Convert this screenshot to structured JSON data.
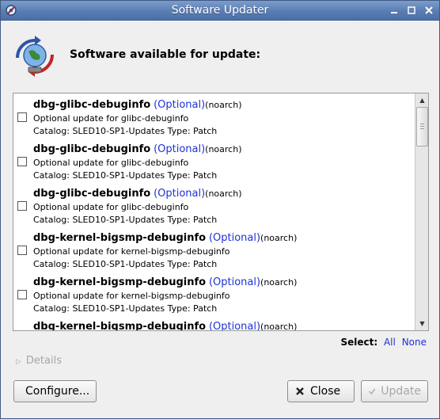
{
  "window": {
    "title": "Software Updater",
    "controls": [
      "minimize-icon",
      "maximize-icon",
      "close-icon"
    ]
  },
  "header": {
    "title": "Software available for update:"
  },
  "updates": [
    {
      "name": "dbg-glibc-debuginfo",
      "tag": "(Optional)",
      "arch": "(noarch)",
      "description": "Optional update for glibc-debuginfo",
      "catalog": "Catalog: SLED10-SP1-Updates Type: Patch",
      "checked": false
    },
    {
      "name": "dbg-glibc-debuginfo",
      "tag": "(Optional)",
      "arch": "(noarch)",
      "description": "Optional update for glibc-debuginfo",
      "catalog": "Catalog: SLED10-SP1-Updates Type: Patch",
      "checked": false
    },
    {
      "name": "dbg-glibc-debuginfo",
      "tag": "(Optional)",
      "arch": "(noarch)",
      "description": "Optional update for glibc-debuginfo",
      "catalog": "Catalog: SLED10-SP1-Updates Type: Patch",
      "checked": false
    },
    {
      "name": "dbg-kernel-bigsmp-debuginfo",
      "tag": "(Optional)",
      "arch": "(noarch)",
      "description": "Optional update for kernel-bigsmp-debuginfo",
      "catalog": "Catalog: SLED10-SP1-Updates Type: Patch",
      "checked": false
    },
    {
      "name": "dbg-kernel-bigsmp-debuginfo",
      "tag": "(Optional)",
      "arch": "(noarch)",
      "description": "Optional update for kernel-bigsmp-debuginfo",
      "catalog": "Catalog: SLED10-SP1-Updates Type: Patch",
      "checked": false
    },
    {
      "name": "dbg-kernel-bigsmp-debuginfo",
      "tag": "(Optional)",
      "arch": "(noarch)",
      "description": "",
      "catalog": "",
      "checked": false
    }
  ],
  "select": {
    "label": "Select:",
    "all": "All",
    "none": "None"
  },
  "details": {
    "label": "Details"
  },
  "buttons": {
    "configure": "Configure...",
    "close": "Close",
    "update": "Update"
  },
  "colors": {
    "link": "#1f31d6",
    "titlebar": "#5a7db3",
    "disabled": "#a8a8a8"
  }
}
